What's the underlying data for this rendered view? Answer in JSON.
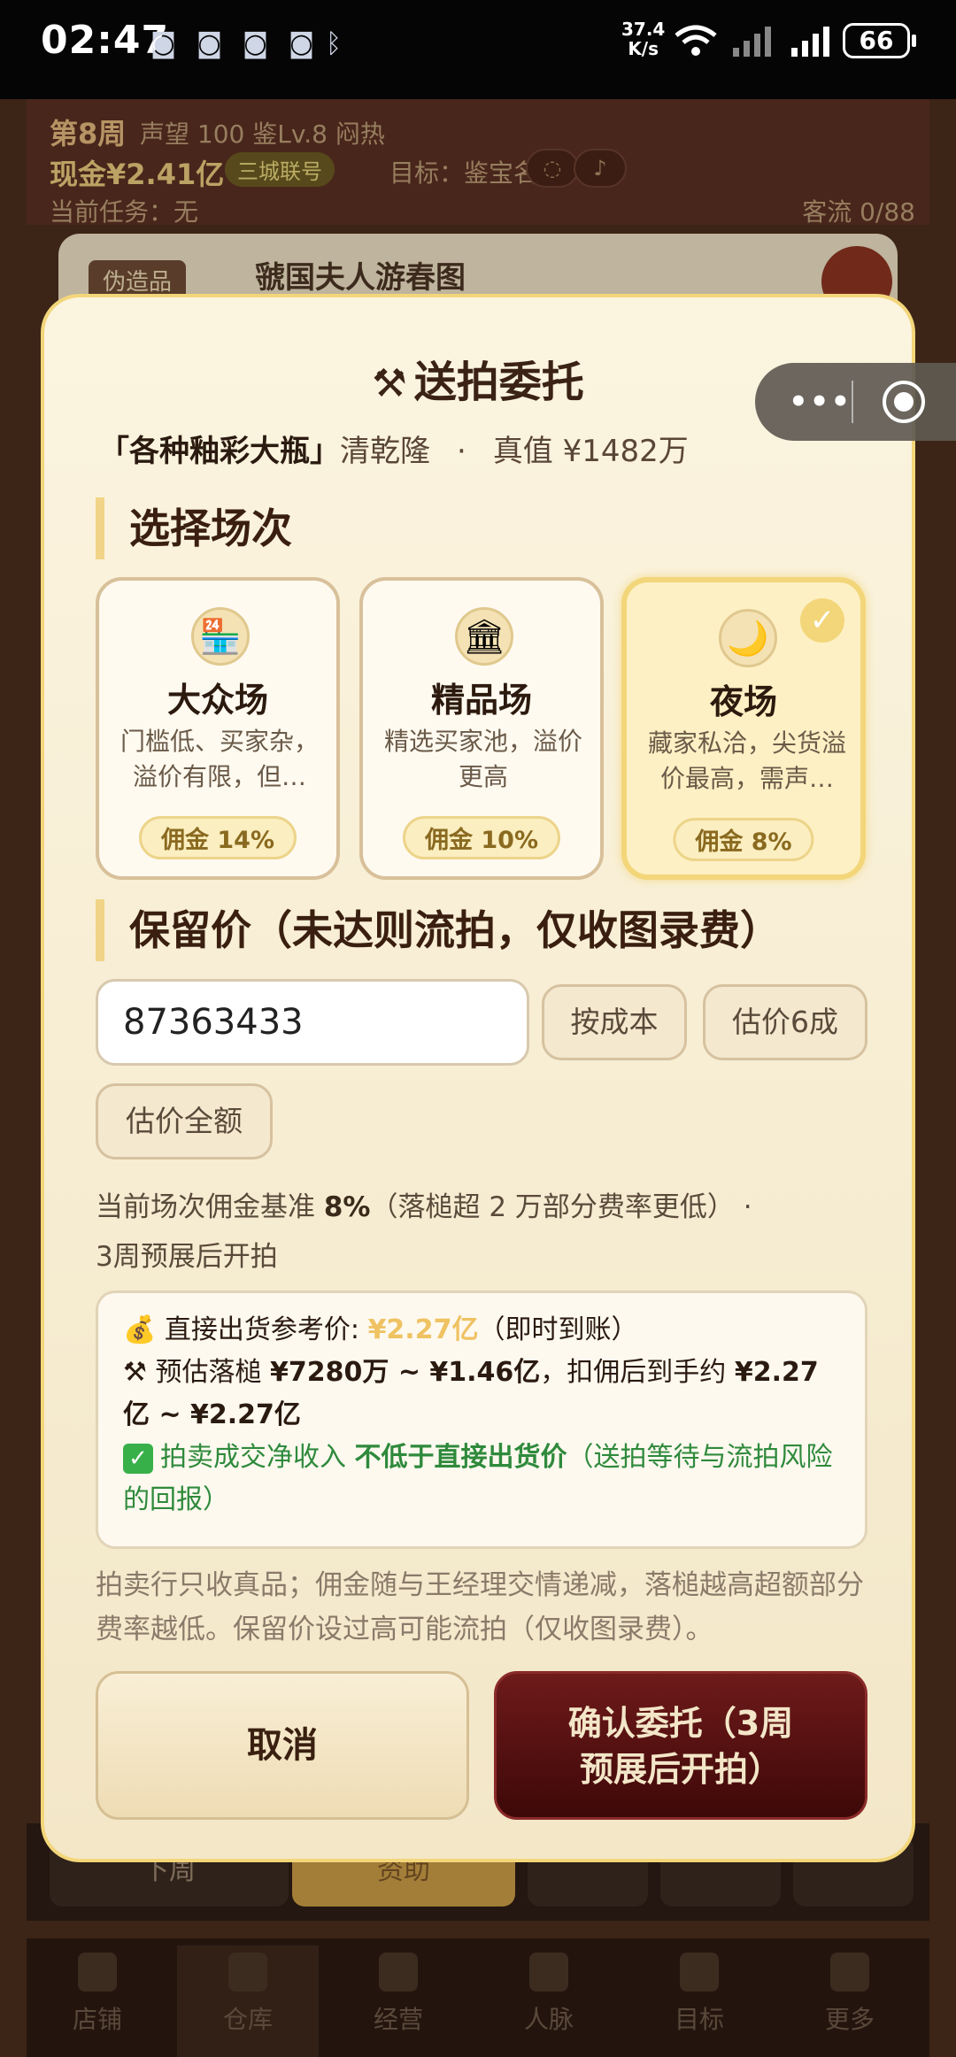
{
  "status_bar": {
    "time": "02:47",
    "net_speed": "37.4",
    "net_unit": "K/s",
    "battery": "66"
  },
  "background": {
    "week": "第8周",
    "reputation": "声望 100  鉴Lv.8",
    "mood": "闷热",
    "cash": "现金¥2.41亿",
    "badge": "三城联号",
    "goal": "目标：鉴宝名家",
    "task": "当前任务：无",
    "flow": "客流 0/88",
    "item_tag": "伪造品",
    "item_name": "虢国夫人游春图",
    "next_week": "下周",
    "help": "资助",
    "tabs": [
      "店铺",
      "仓库",
      "经营",
      "人脉",
      "目标",
      "更多"
    ]
  },
  "modal": {
    "title": "送拍委托",
    "item_name": "「各种釉彩大瓶」",
    "item_era": "清乾隆",
    "dot": "·",
    "item_value": "真值 ¥1482万",
    "venue_section": "选择场次",
    "venues": [
      {
        "name": "大众场",
        "desc": "门槛低、买家杂，溢价有限，但…",
        "fee": "佣金 14%",
        "icon": "shop-icon"
      },
      {
        "name": "精品场",
        "desc": "精选买家池，溢价更高",
        "fee": "佣金 10%",
        "icon": "museum-icon"
      },
      {
        "name": "夜场",
        "desc": "藏家私洽，尖货溢价最高，需声…",
        "fee": "佣金 8%",
        "icon": "moon-icon",
        "selected": true
      }
    ],
    "reserve_section": "保留价（未达则流拍，仅收图录费）",
    "reserve_value": "87363433",
    "chips": {
      "cost": "按成本",
      "sixty": "估价6成",
      "full": "估价全额"
    },
    "note_prefix": "当前场次佣金基准 ",
    "note_rate": "8%",
    "note_suffix": "（落槌超 2 万部分费率更低）  ·",
    "note_line2": "3周预展后开拍",
    "info": {
      "direct_label": "直接出货参考价: ",
      "direct_value": "¥2.27亿",
      "direct_suffix": "（即时到账）",
      "estimate_label": "预估落槌 ",
      "estimate_range": "¥7280万 ~ ¥1.46亿",
      "estimate_mid": "，扣佣后到手约 ",
      "estimate_net": "¥2.27亿 ~ ¥2.27亿",
      "green_prefix": "拍卖成交净收入 ",
      "green_bold": "不低于直接出货价",
      "green_suffix": "（送拍等待与流拍风险的回报）"
    },
    "footnote": "拍卖行只收真品；佣金随与王经理交情递减，落槌越高超额部分费率越低。保留价设过高可能流拍（仅收图录费）。",
    "cancel": "取消",
    "confirm_line1": "确认委托（3周",
    "confirm_line2": "预展后开拍）"
  },
  "colors": {
    "accent_gold": "#f3d67a",
    "confirm_bg": "#4e0e0e",
    "green": "#2f8a3c"
  }
}
